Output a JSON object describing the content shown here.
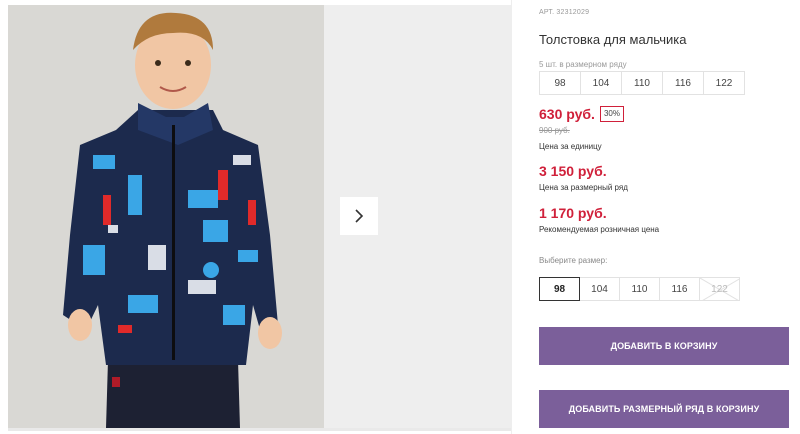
{
  "product": {
    "sku": "АРТ. 32312029",
    "title": "Толстовка для мальчика",
    "range_note": "5 шт. в размерном ряду",
    "range_sizes": [
      "98",
      "104",
      "110",
      "116",
      "122"
    ]
  },
  "pricing": {
    "unit_price": "630 руб.",
    "discount": "30%",
    "old_price": "900 руб.",
    "unit_caption": "Цена за единицу",
    "range_price": "3 150 руб.",
    "range_caption": "Цена за размерный ряд",
    "retail_price": "1 170 руб.",
    "retail_caption": "Рекомендуемая розничная цена"
  },
  "size_selector": {
    "label": "Выберите размер:",
    "options": [
      {
        "label": "98",
        "state": "selected"
      },
      {
        "label": "104",
        "state": "available"
      },
      {
        "label": "110",
        "state": "available"
      },
      {
        "label": "116",
        "state": "available"
      },
      {
        "label": "122",
        "state": "unavailable"
      }
    ]
  },
  "actions": {
    "add_to_cart": "Добавить в корзину",
    "add_range_to_cart": "Добавить размерный ряд в корзину"
  },
  "gallery": {
    "next_icon": "chevron-right-icon"
  },
  "colors": {
    "price_red": "#d0203a",
    "button_purple": "#7b5f9a"
  }
}
